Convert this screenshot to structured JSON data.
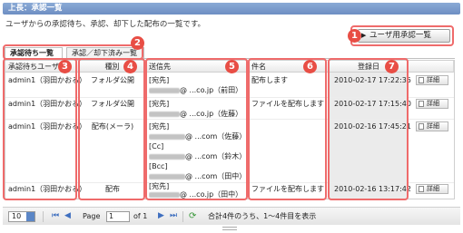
{
  "title": "上長：承認一覧",
  "description": "ユーザからの承認待ち、承認、却下した配布の一覧です。",
  "user_approval_button": "ユーザ用承認一覧",
  "tabs": [
    "承認待ち一覧",
    "承認／却下済み一覧"
  ],
  "columns": [
    "承認待ちユーザ",
    "種別",
    "送信先",
    "件名",
    "登録日"
  ],
  "detail_label": "詳細",
  "rows": [
    {
      "user": "admin1（羽田かおる）",
      "type": "フォルダ公開",
      "to_label": "[宛先]",
      "to_addr": "@ ...co.jp（前田）",
      "subject": "配布します",
      "date": "2010-02-17 17:22:35"
    },
    {
      "user": "admin1（羽田かおる）",
      "type": "フォルダ公開",
      "to_label": "[宛先]",
      "to_addr": "@ ...co.jp（佐藤）",
      "subject": "ファイルを配布します",
      "date": "2010-02-17 17:15:40"
    },
    {
      "user": "admin1（羽田かおる）",
      "type": "配布(メーラ)",
      "to_label": "[宛先]",
      "to_addr": "@ ...com（佐藤）",
      "cc_label": "[Cc]",
      "cc_addr": "@ ...com（鈴木）",
      "bcc_label": "[Bcc]",
      "bcc_addr": "@ ...com（田中）",
      "subject": "",
      "date": "2010-02-16 17:45:21"
    },
    {
      "user": "admin1（羽田かおる）",
      "type": "配布",
      "to_label": "[宛先]",
      "to_addr": "@ ...co.jp（田中）",
      "subject": "ファイルを配布します",
      "date": "2010-02-16 13:17:42"
    }
  ],
  "pager": {
    "page_size": "10",
    "page_label": "Page",
    "page_value": "1",
    "of_label": "of 1",
    "summary": "合計4件のうち、1〜4件目を表示"
  },
  "badges": [
    "1",
    "2",
    "3",
    "4",
    "5",
    "6",
    "7"
  ],
  "colors": {
    "accent": "#6e8fc3",
    "badge": "#e84e45",
    "highlight_border": "#ef6b6b",
    "date_column_bg": "#ebebeb"
  }
}
